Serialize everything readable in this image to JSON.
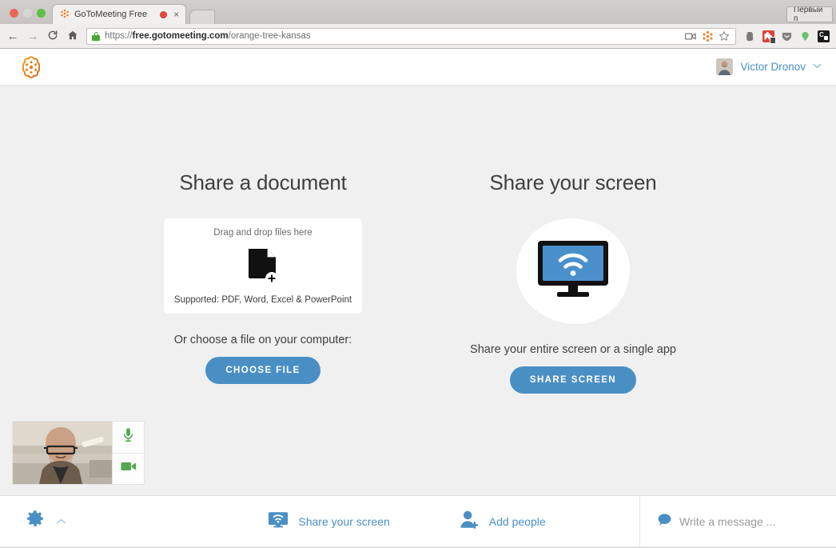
{
  "browser": {
    "window_controls": [
      "close",
      "minimize",
      "maximize"
    ],
    "tab": {
      "title": "GoToMeeting Free",
      "favicon": "gotomeeting-flower-icon",
      "recording_indicator": "recording-dot-icon",
      "close_label": "×"
    },
    "new_tab_label": "",
    "profile_button_label": "Первый п",
    "nav": {
      "back": "←",
      "forward": "→",
      "reload": "C",
      "home": "⌂"
    },
    "omnibox": {
      "scheme": "https://",
      "host": "free.gotomeeting.com",
      "path": "/orange-tree-kansas",
      "full_url": "https://free.gotomeeting.com/orange-tree-kansas",
      "lock_icon": "green-lock-icon"
    },
    "omnibox_icons": [
      "screencast-icon",
      "gotomeeting-icon",
      "bookmark-star-icon"
    ],
    "extensions": [
      "evernote-icon",
      "puzzle-extension-icon",
      "shield-icon",
      "pin-drop-icon",
      "clipboard-icon"
    ]
  },
  "app": {
    "logo": "gotomeeting-logo",
    "user": {
      "name": "Victor Dronov",
      "avatar": "user-avatar",
      "chevron": "⌄"
    }
  },
  "main": {
    "document_panel": {
      "title": "Share a document",
      "drop_hint": "Drag and drop files here",
      "doc_icon": "document-plus-icon",
      "supported": "Supported: PDF, Word, Excel & PowerPoint",
      "choose_label": "Or choose a file on your computer:",
      "button_label": "CHOOSE FILE"
    },
    "screen_panel": {
      "title": "Share your screen",
      "icon": "monitor-wifi-icon",
      "caption": "Share your entire screen or a single app",
      "button_label": "SHARE SCREEN"
    },
    "webcam": {
      "mic_icon": "microphone-icon",
      "camera_icon": "video-camera-icon",
      "mic_state": "on",
      "camera_state": "on"
    }
  },
  "bottom_bar": {
    "settings_icon": "gear-icon",
    "settings_chevron": "⌃",
    "share_screen": {
      "icon": "monitor-wifi-icon",
      "label": "Share your screen"
    },
    "add_people": {
      "icon": "add-person-icon",
      "label": "Add people"
    },
    "chat": {
      "icon": "chat-bubble-icon",
      "placeholder": "Write a message ..."
    }
  },
  "colors": {
    "accent_blue": "#4a8fc4",
    "logo_orange": "#e58a22",
    "page_bg": "#f0f0f0",
    "green": "#4ca64c"
  }
}
